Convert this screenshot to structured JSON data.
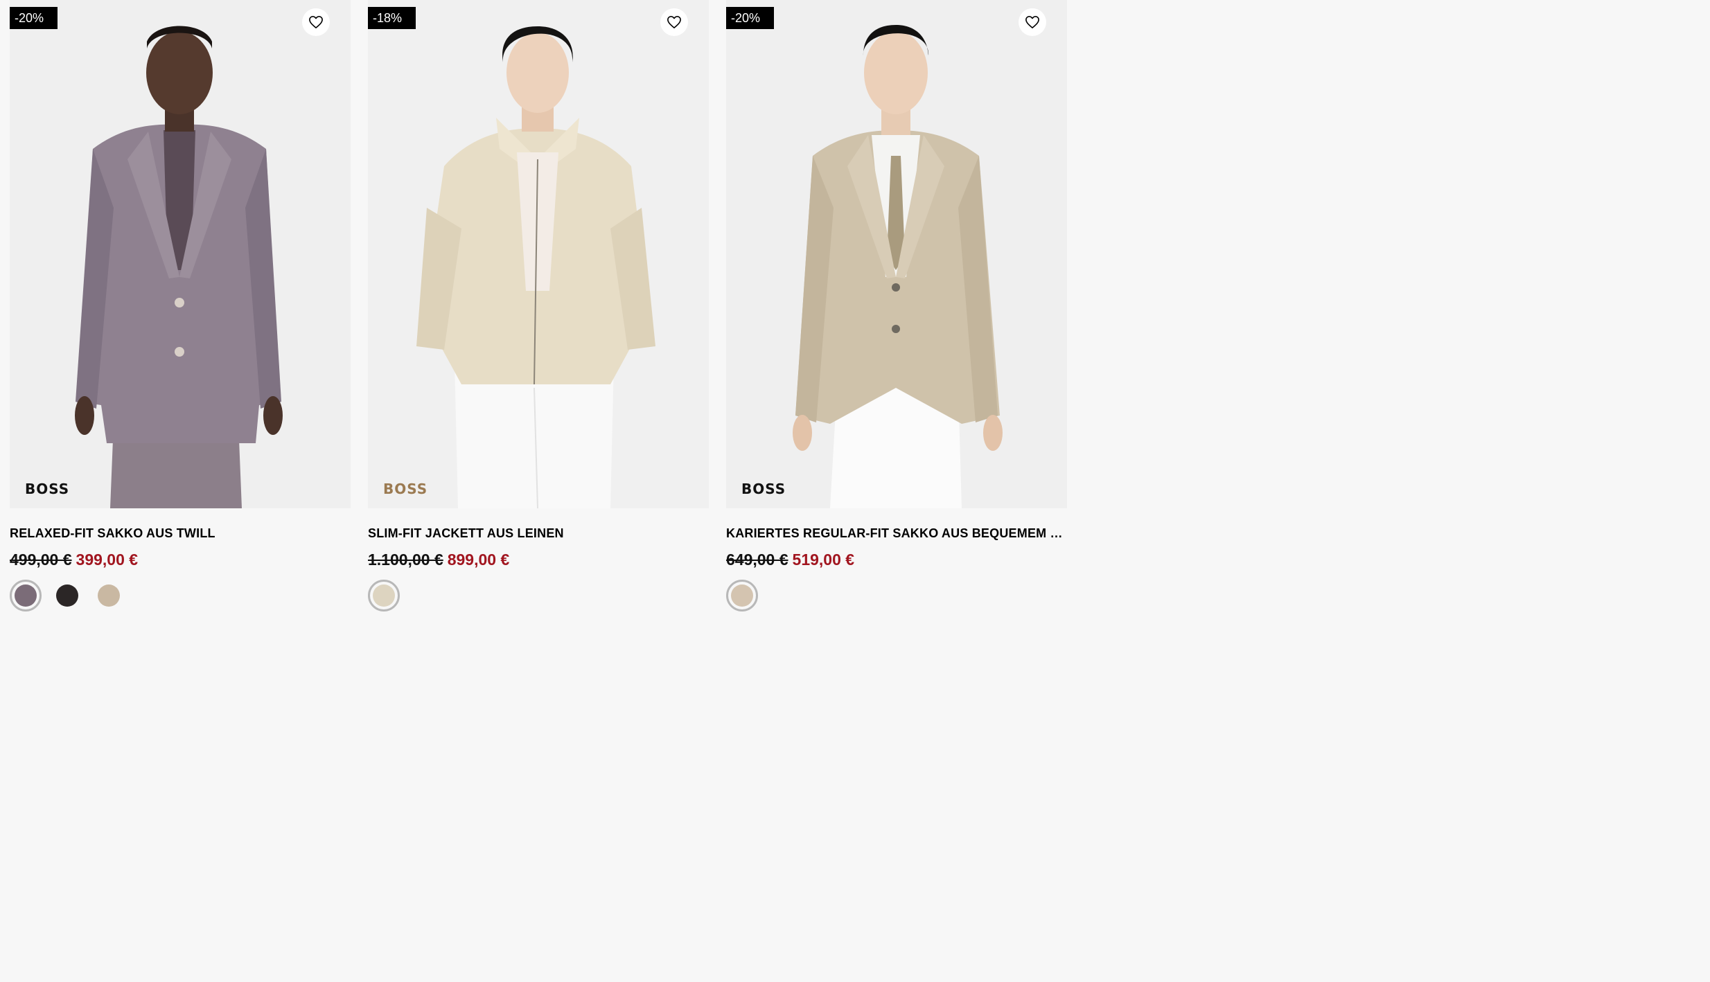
{
  "products": [
    {
      "discount": "-20%",
      "brand": "BOSS",
      "brand_color": "#111111",
      "title": "RELAXED-FIT SAKKO AUS TWILL",
      "old_price": "499,00 €",
      "new_price": "399,00 €",
      "swatches": [
        "#7b6c78",
        "#2b2626",
        "#c9b8a2"
      ],
      "selected_swatch": 0
    },
    {
      "discount": "-18%",
      "brand": "BOSS",
      "brand_color": "#9b7a51",
      "title": "SLIM-FIT JACKETT AUS LEINEN",
      "old_price": "1.100,00 €",
      "new_price": "899,00 €",
      "swatches": [
        "#ddd4c0"
      ],
      "selected_swatch": 0
    },
    {
      "discount": "-20%",
      "brand": "BOSS",
      "brand_color": "#111111",
      "title": "KARIERTES REGULAR-FIT SAKKO AUS BEQUEMEM STRETCH",
      "old_price": "649,00 €",
      "new_price": "519,00 €",
      "swatches": [
        "#d4c4b0"
      ],
      "selected_swatch": 0
    }
  ],
  "icons": {
    "wishlist": "heart-outline-icon"
  },
  "colors": {
    "sale_price": "#a1151f",
    "badge_bg": "#000000"
  }
}
